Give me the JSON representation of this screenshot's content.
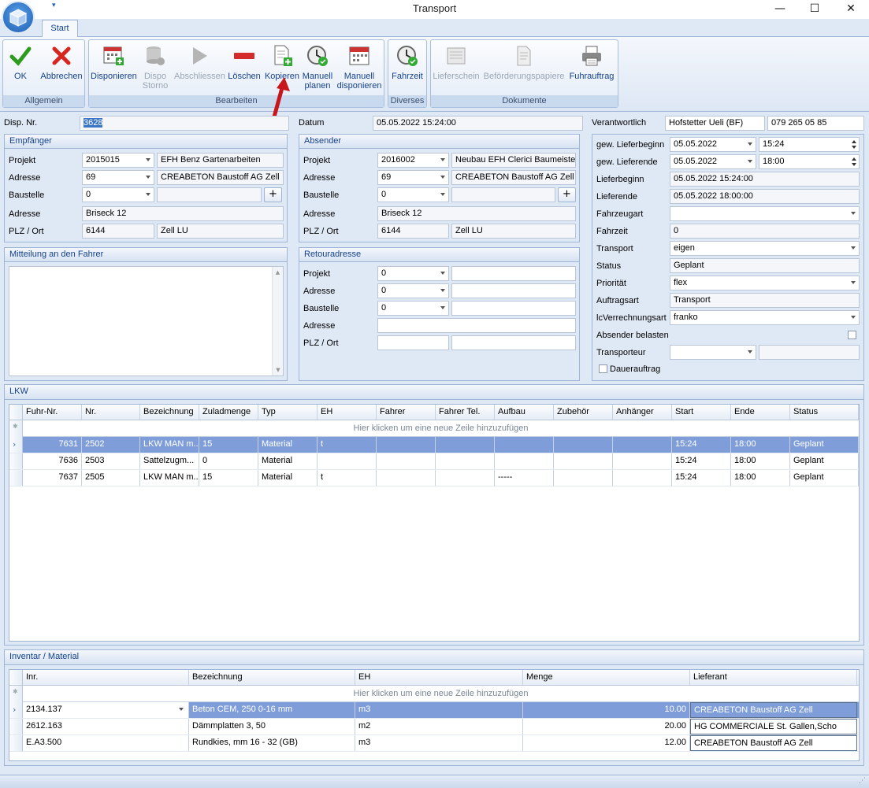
{
  "window": {
    "title": "Transport",
    "minimize": "—",
    "maximize": "☐",
    "close": "✕"
  },
  "ribbon": {
    "tab": "Start",
    "groups": {
      "allgemein": "Allgemein",
      "bearbeiten": "Bearbeiten",
      "diverses": "Diverses",
      "dokumente": "Dokumente"
    },
    "buttons": {
      "ok": "OK",
      "abbrechen": "Abbrechen",
      "disponieren": "Disponieren",
      "dispo_storno_1": "Dispo",
      "dispo_storno_2": "Storno",
      "abschliessen": "Abschliessen",
      "loeschen": "Löschen",
      "kopieren": "Kopieren",
      "manuell_planen_1": "Manuell",
      "manuell_planen_2": "planen",
      "manuell_disp_1": "Manuell",
      "manuell_disp_2": "disponieren",
      "fahrzeit": "Fahrzeit",
      "lieferschein": "Lieferschein",
      "befoerderung": "Beförderungspapiere",
      "fuhrauftrag": "Fuhrauftrag"
    }
  },
  "header": {
    "disp_nr_label": "Disp. Nr.",
    "disp_nr": "3628",
    "datum_label": "Datum",
    "datum": "05.05.2022 15:24:00",
    "verantwortlich_label": "Verantwortlich",
    "verantwortlich": "Hofstetter Ueli (BF)",
    "telefon": "079 265 05 85"
  },
  "empfaenger": {
    "title": "Empfänger",
    "projekt_label": "Projekt",
    "projekt": "2015015",
    "projekt_name": "EFH Benz Gartenarbeiten",
    "adresse_label": "Adresse",
    "adresse": "69",
    "adresse_name": "CREABETON Baustoff AG Zell",
    "baustelle_label": "Baustelle",
    "baustelle": "0",
    "adresse2_label": "Adresse",
    "strasse": "Briseck 12",
    "plz_label": "PLZ / Ort",
    "plz": "6144",
    "ort": "Zell LU"
  },
  "absender": {
    "title": "Absender",
    "projekt_label": "Projekt",
    "projekt": "2016002",
    "projekt_name": "Neubau EFH Clerici Baumeistera",
    "adresse_label": "Adresse",
    "adresse": "69",
    "adresse_name": "CREABETON Baustoff AG Zell",
    "baustelle_label": "Baustelle",
    "baustelle": "0",
    "adresse2_label": "Adresse",
    "strasse": "Briseck 12",
    "plz_label": "PLZ / Ort",
    "plz": "6144",
    "ort": "Zell LU"
  },
  "mitteilung": {
    "title": "Mitteilung an den Fahrer"
  },
  "retour": {
    "title": "Retouradresse",
    "projekt_label": "Projekt",
    "projekt": "0",
    "adresse_label": "Adresse",
    "adresse": "0",
    "baustelle_label": "Baustelle",
    "baustelle": "0",
    "adresse2_label": "Adresse",
    "plz_label": "PLZ / Ort"
  },
  "details": {
    "gew_lieferbeginn_label": "gew. Lieferbeginn",
    "gew_lieferbeginn_date": "05.05.2022",
    "gew_lieferbeginn_time": "15:24",
    "gew_lieferende_label": "gew. Lieferende",
    "gew_lieferende_date": "05.05.2022",
    "gew_lieferende_time": "18:00",
    "lieferbeginn_label": "Lieferbeginn",
    "lieferbeginn": "05.05.2022 15:24:00",
    "lieferende_label": "Lieferende",
    "lieferende": "05.05.2022 18:00:00",
    "fahrzeugart_label": "Fahrzeugart",
    "fahrzeugart": "",
    "fahrzeit_label": "Fahrzeit",
    "fahrzeit": "0",
    "transport_label": "Transport",
    "transport": "eigen",
    "status_label": "Status",
    "status": "Geplant",
    "prioritaet_label": "Priorität",
    "prioritaet": "flex",
    "auftragsart_label": "Auftragsart",
    "auftragsart": "Transport",
    "verrechnungsart_label": "lcVerrechnungsart",
    "verrechnungsart": "franko",
    "absender_belasten_label": "Absender belasten",
    "transporteur_label": "Transporteur",
    "dauerauftrag_label": "Dauerauftrag"
  },
  "lkw": {
    "title": "LKW",
    "new_row": "Hier klicken um eine neue Zeile hinzuzufügen",
    "columns": [
      "Fuhr-Nr.",
      "Nr.",
      "Bezeichnung",
      "Zuladmenge",
      "Typ",
      "EH",
      "Fahrer",
      "Fahrer Tel.",
      "Aufbau",
      "Zubehör",
      "Anhänger",
      "Start",
      "Ende",
      "Status"
    ],
    "rows": [
      [
        "7631",
        "2502",
        "LKW MAN m...",
        "15",
        "Material",
        "t",
        "",
        "",
        "",
        "",
        "",
        "15:24",
        "18:00",
        "Geplant"
      ],
      [
        "7636",
        "2503",
        "Sattelzugm...",
        "0",
        "Material",
        "",
        "",
        "",
        "",
        "",
        "",
        "15:24",
        "18:00",
        "Geplant"
      ],
      [
        "7637",
        "2505",
        "LKW MAN m...",
        "15",
        "Material",
        "t",
        "",
        "",
        "-----",
        "",
        "",
        "15:24",
        "18:00",
        "Geplant"
      ]
    ]
  },
  "inventar": {
    "title": "Inventar / Material",
    "new_row": "Hier klicken um eine neue Zeile hinzuzufügen",
    "columns": [
      "Inr.",
      "Bezeichnung",
      "EH",
      "Menge",
      "Lieferant"
    ],
    "rows": [
      [
        "2134.137",
        "Beton CEM, 250  0-16 mm",
        "m3",
        "10.00",
        "CREABETON Baustoff AG Zell"
      ],
      [
        "2612.163",
        "Dämmplatten 3, 50",
        "m2",
        "20.00",
        "HG COMMERCIALE St. Gallen,Scho"
      ],
      [
        "E.A3.500",
        "Rundkies, mm 16 - 32 (GB)",
        "m3",
        "12.00",
        "CREABETON Baustoff AG Zell"
      ]
    ]
  },
  "colors": {
    "accent": "#15428b",
    "selection": "#7f9ed9",
    "annotation_arrow": "#c8161d"
  }
}
